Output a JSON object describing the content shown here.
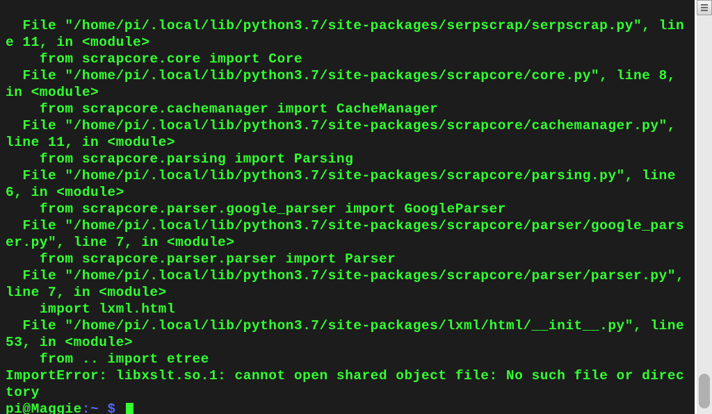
{
  "terminal": {
    "lines": [
      "  File \"/home/pi/.local/lib/python3.7/site-packages/serpscrap/serpscrap.py\", line 11, in <module>",
      "    from scrapcore.core import Core",
      "  File \"/home/pi/.local/lib/python3.7/site-packages/scrapcore/core.py\", line 8, in <module>",
      "    from scrapcore.cachemanager import CacheManager",
      "  File \"/home/pi/.local/lib/python3.7/site-packages/scrapcore/cachemanager.py\", line 11, in <module>",
      "    from scrapcore.parsing import Parsing",
      "  File \"/home/pi/.local/lib/python3.7/site-packages/scrapcore/parsing.py\", line 6, in <module>",
      "    from scrapcore.parser.google_parser import GoogleParser",
      "  File \"/home/pi/.local/lib/python3.7/site-packages/scrapcore/parser/google_parser.py\", line 7, in <module>",
      "    from scrapcore.parser.parser import Parser",
      "  File \"/home/pi/.local/lib/python3.7/site-packages/scrapcore/parser/parser.py\", line 7, in <module>",
      "    import lxml.html",
      "  File \"/home/pi/.local/lib/python3.7/site-packages/lxml/html/__init__.py\", line 53, in <module>",
      "    from .. import etree",
      "ImportError: libxslt.so.1: cannot open shared object file: No such file or directory"
    ],
    "prompt": {
      "user": "pi",
      "at": "@",
      "host": "Maggie",
      "sep": ":",
      "path": "~",
      "dollar": " $ "
    }
  }
}
